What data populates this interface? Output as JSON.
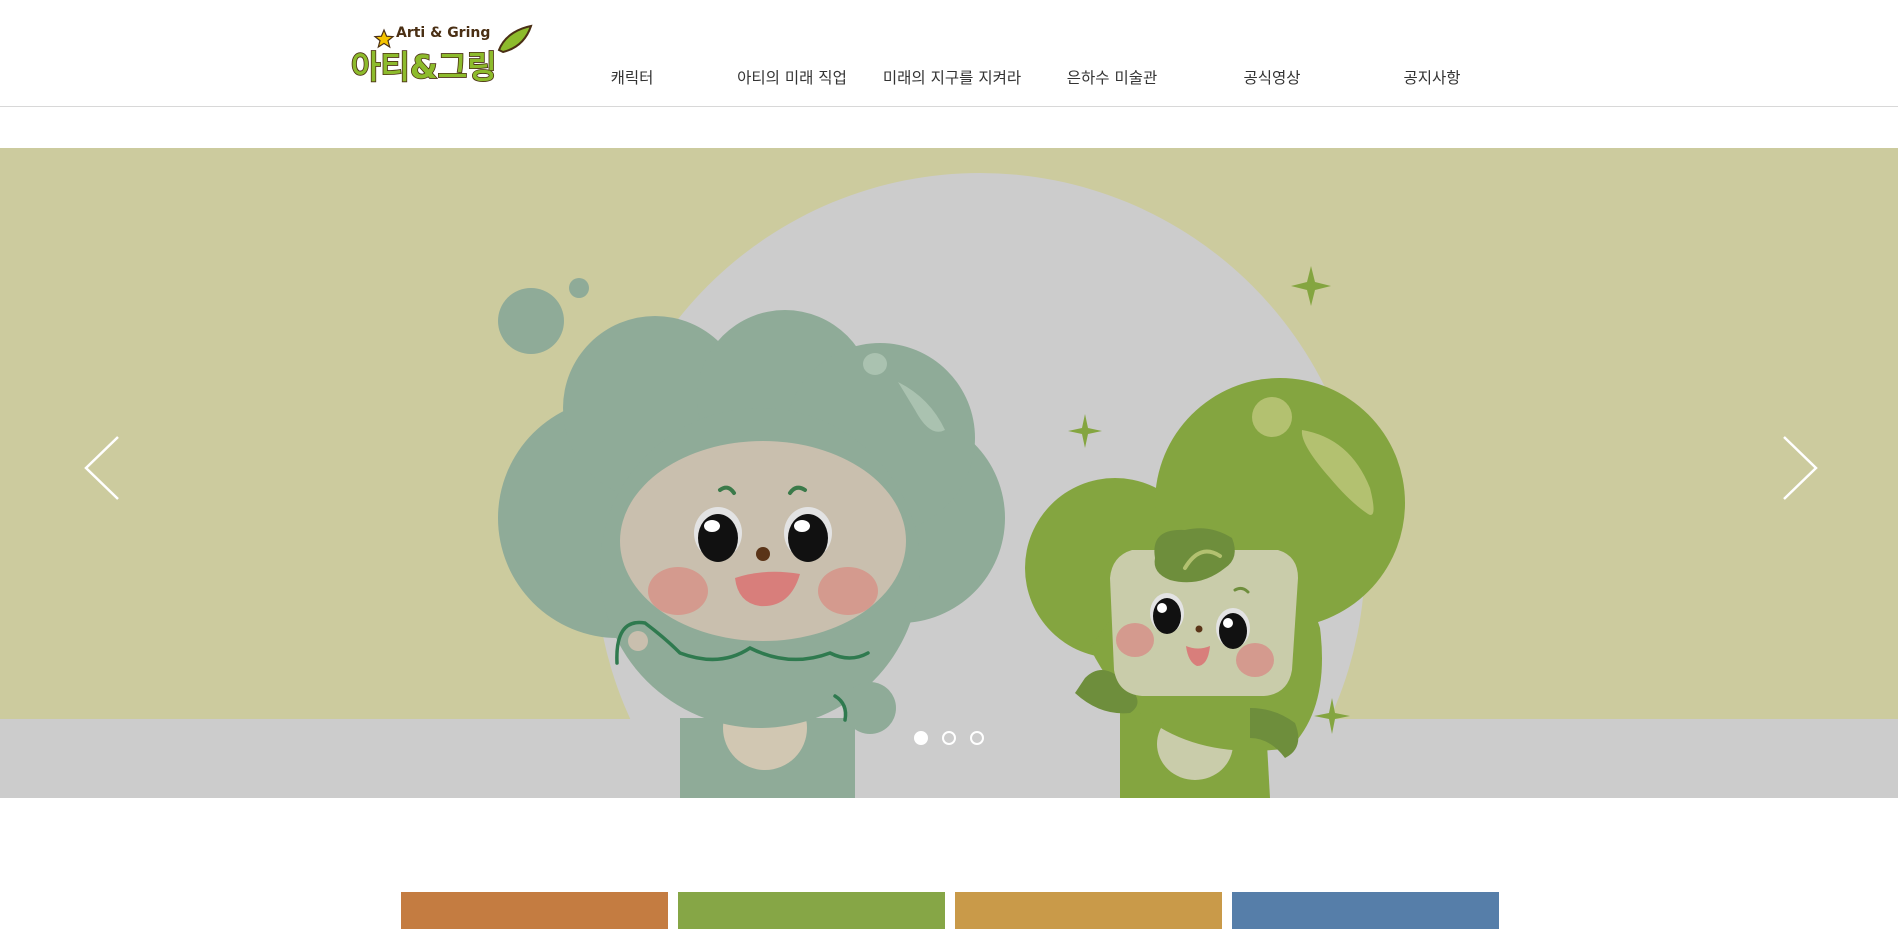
{
  "header": {
    "logo": {
      "top_text": "Arti & Gring",
      "main_text": "아티&그링",
      "colors": {
        "outline": "#4a2f14",
        "green": "#8dbb2c",
        "mint": "#8fc8b6",
        "star": "#f5c400"
      }
    },
    "nav": [
      {
        "label": "캐릭터"
      },
      {
        "label": "아티의 미래 직업"
      },
      {
        "label": "미래의 지구를 지켜라"
      },
      {
        "label": "은하수 미술관"
      },
      {
        "label": "공식영상"
      },
      {
        "label": "공지사항"
      }
    ]
  },
  "slider": {
    "background_color": "#cccb9e",
    "floor_color": "#cccccc",
    "characters": [
      "arti-character",
      "gring-character"
    ],
    "prev_icon": "chevron-left-icon",
    "next_icon": "chevron-right-icon",
    "slide_count": 3,
    "active_slide": 1
  },
  "tiles": [
    {
      "color": "#c47c41"
    },
    {
      "color": "#86a646"
    },
    {
      "color": "#c99a49"
    },
    {
      "color": "#567ea9"
    }
  ]
}
